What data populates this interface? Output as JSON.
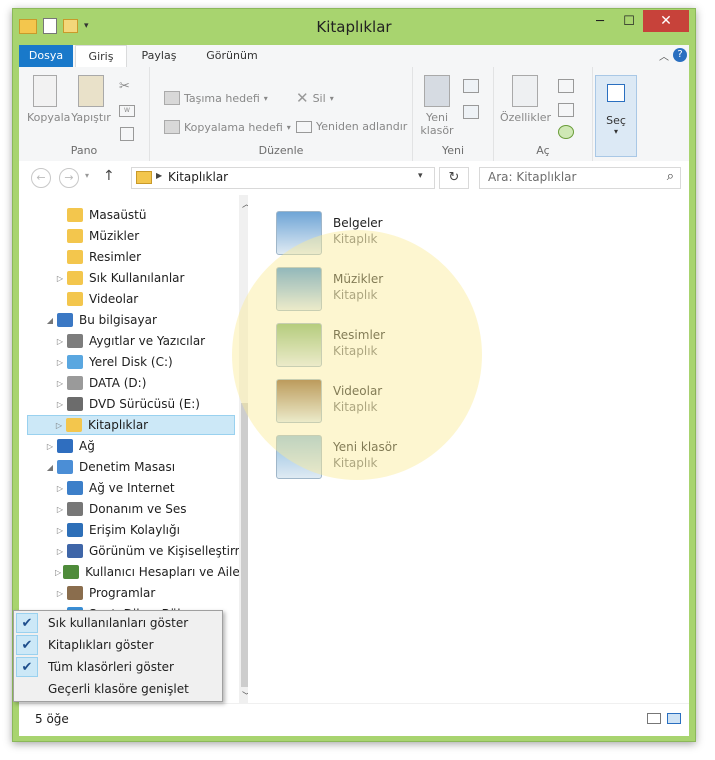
{
  "window": {
    "title": "Kitaplıklar"
  },
  "menu_tabs": [
    "Dosya",
    "Giriş",
    "Paylaş",
    "Görünüm"
  ],
  "ribbon": {
    "pano": {
      "label": "Pano",
      "copy": "Kopyala",
      "paste": "Yapıştır"
    },
    "duzenle": {
      "label": "Düzenle",
      "move_to": "Taşıma hedefi",
      "copy_to": "Kopyalama hedefi",
      "delete": "Sil",
      "rename": "Yeniden adlandır"
    },
    "yeni": {
      "label": "Yeni",
      "new_folder": "Yeni klasör"
    },
    "ac": {
      "label": "Aç",
      "properties": "Özellikler"
    },
    "sec": {
      "label": "Seç"
    }
  },
  "address": {
    "path": "Kitaplıklar",
    "search_placeholder": "Ara: Kitaplıklar"
  },
  "nav_items": [
    {
      "label": "Masaüstü",
      "indent": 2,
      "arrow": "",
      "color": "#f3c64d"
    },
    {
      "label": "Müzikler",
      "indent": 2,
      "arrow": "",
      "color": "#f3c64d"
    },
    {
      "label": "Resimler",
      "indent": 2,
      "arrow": "",
      "color": "#f3c64d"
    },
    {
      "label": "Sık Kullanılanlar",
      "indent": 2,
      "arrow": "▷",
      "color": "#f3c64d"
    },
    {
      "label": "Videolar",
      "indent": 2,
      "arrow": "",
      "color": "#f3c64d"
    },
    {
      "label": "Bu bilgisayar",
      "indent": 1,
      "arrow": "◢",
      "color": "#3b78c4"
    },
    {
      "label": "Aygıtlar ve Yazıcılar",
      "indent": 2,
      "arrow": "▷",
      "color": "#7d7d7d"
    },
    {
      "label": "Yerel Disk (C:)",
      "indent": 2,
      "arrow": "▷",
      "color": "#5aa7e0"
    },
    {
      "label": "DATA (D:)",
      "indent": 2,
      "arrow": "▷",
      "color": "#9a9a9a"
    },
    {
      "label": "DVD Sürücüsü (E:)",
      "indent": 2,
      "arrow": "▷",
      "color": "#6c6c6c"
    },
    {
      "label": "Kitaplıklar",
      "indent": 1,
      "arrow": "▷",
      "color": "#f3c64d",
      "selected": true
    },
    {
      "label": "Ağ",
      "indent": 1,
      "arrow": "▷",
      "color": "#2f6ebf"
    },
    {
      "label": "Denetim Masası",
      "indent": 1,
      "arrow": "◢",
      "color": "#4b8ed6"
    },
    {
      "label": "Ağ ve Internet",
      "indent": 2,
      "arrow": "▷",
      "color": "#3c7fc9"
    },
    {
      "label": "Donanım ve Ses",
      "indent": 2,
      "arrow": "▷",
      "color": "#777777"
    },
    {
      "label": "Erişim Kolaylığı",
      "indent": 2,
      "arrow": "▷",
      "color": "#2e6fb8"
    },
    {
      "label": "Görünüm ve Kişiselleştirme",
      "indent": 2,
      "arrow": "▷",
      "color": "#3f66a8"
    },
    {
      "label": "Kullanıcı Hesapları ve Aile Koruması",
      "indent": 2,
      "arrow": "▷",
      "color": "#4e8b3a"
    },
    {
      "label": "Programlar",
      "indent": 2,
      "arrow": "▷",
      "color": "#8a6d4d"
    },
    {
      "label": "Saat, Dil ve Bölge",
      "indent": 2,
      "arrow": "▷",
      "color": "#3a8fd6"
    }
  ],
  "libraries": [
    {
      "name": "Belgeler",
      "type": "Kitaplık",
      "color": "#6fa5d6"
    },
    {
      "name": "Müzikler",
      "type": "Kitaplık",
      "color": "#3f8fd8"
    },
    {
      "name": "Resimler",
      "type": "Kitaplık",
      "color": "#7db46a"
    },
    {
      "name": "Videolar",
      "type": "Kitaplık",
      "color": "#8a5b2e"
    },
    {
      "name": "Yeni klasör",
      "type": "Kitaplık",
      "color": "#8fbfe0"
    }
  ],
  "context_menu": [
    {
      "label": "Sık kullanılanları göster",
      "checked": true
    },
    {
      "label": "Kitaplıkları göster",
      "checked": true
    },
    {
      "label": "Tüm klasörleri göster",
      "checked": true
    },
    {
      "label": "Geçerli klasöre genişlet",
      "checked": false
    }
  ],
  "status": {
    "count": "5 öğe"
  },
  "colors": {
    "accent": "#1979ca",
    "selection": "#cce8f7",
    "frame": "#a8d46f"
  }
}
